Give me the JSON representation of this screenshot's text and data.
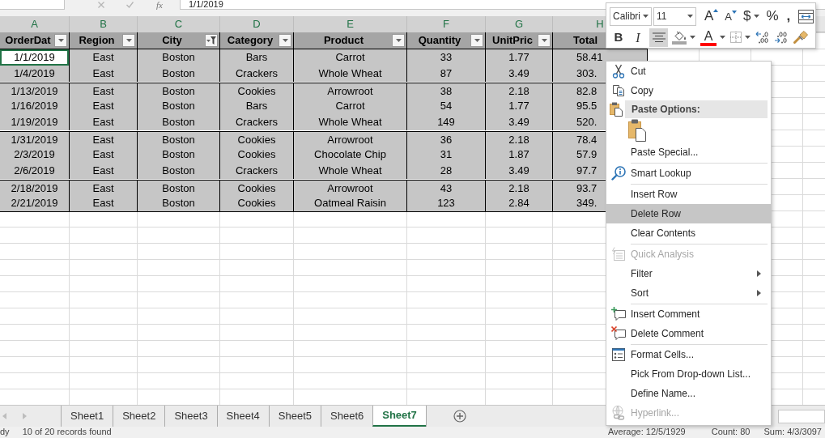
{
  "formula_bar": {
    "function_label": "fx",
    "value": "1/1/2019"
  },
  "columns": [
    {
      "letter": "A",
      "selected": true,
      "active": true,
      "header": "OrderDat",
      "filtered": false
    },
    {
      "letter": "B",
      "selected": true,
      "active": false,
      "header": "Region",
      "filtered": false
    },
    {
      "letter": "C",
      "selected": true,
      "active": false,
      "header": "City",
      "filtered": true
    },
    {
      "letter": "D",
      "selected": true,
      "active": false,
      "header": "Category",
      "filtered": false
    },
    {
      "letter": "E",
      "selected": true,
      "active": false,
      "header": "Product",
      "filtered": false
    },
    {
      "letter": "F",
      "selected": true,
      "active": false,
      "header": "Quantity",
      "filtered": false
    },
    {
      "letter": "G",
      "selected": true,
      "active": false,
      "header": "UnitPric",
      "filtered": false
    },
    {
      "letter": "H",
      "selected": true,
      "active": false,
      "header": "Total"
    }
  ],
  "rows": [
    {
      "cells": [
        "1/1/2019",
        "East",
        "Boston",
        "Bars",
        "Carrot",
        "33",
        "1.77",
        "58.41"
      ],
      "active": true,
      "hidden_rows_above": false
    },
    {
      "cells": [
        "1/4/2019",
        "East",
        "Boston",
        "Crackers",
        "Whole Wheat",
        "87",
        "3.49",
        "303."
      ],
      "active": false,
      "hidden_rows_above": false
    },
    {
      "cells": [
        "1/13/2019",
        "East",
        "Boston",
        "Cookies",
        "Arrowroot",
        "38",
        "2.18",
        "82.8"
      ],
      "active": false,
      "hidden_rows_above": true
    },
    {
      "cells": [
        "1/16/2019",
        "East",
        "Boston",
        "Bars",
        "Carrot",
        "54",
        "1.77",
        "95.5"
      ],
      "active": false,
      "hidden_rows_above": false
    },
    {
      "cells": [
        "1/19/2019",
        "East",
        "Boston",
        "Crackers",
        "Whole Wheat",
        "149",
        "3.49",
        "520."
      ],
      "active": false,
      "hidden_rows_above": false
    },
    {
      "cells": [
        "1/31/2019",
        "East",
        "Boston",
        "Cookies",
        "Arrowroot",
        "36",
        "2.18",
        "78.4"
      ],
      "active": false,
      "hidden_rows_above": true
    },
    {
      "cells": [
        "2/3/2019",
        "East",
        "Boston",
        "Cookies",
        "Chocolate Chip",
        "31",
        "1.87",
        "57.9"
      ],
      "active": false,
      "hidden_rows_above": false
    },
    {
      "cells": [
        "2/6/2019",
        "East",
        "Boston",
        "Crackers",
        "Whole Wheat",
        "28",
        "3.49",
        "97.7"
      ],
      "active": false,
      "hidden_rows_above": false
    },
    {
      "cells": [
        "2/18/2019",
        "East",
        "Boston",
        "Cookies",
        "Arrowroot",
        "43",
        "2.18",
        "93.7"
      ],
      "active": false,
      "hidden_rows_above": true
    },
    {
      "cells": [
        "2/21/2019",
        "East",
        "Boston",
        "Cookies",
        "Oatmeal Raisin",
        "123",
        "2.84",
        "349."
      ],
      "active": false,
      "hidden_rows_above": false
    }
  ],
  "mini_toolbar": {
    "font_name": "Calibri",
    "font_size": "11",
    "upper_buttons": [
      {
        "kind": "grow_font",
        "label": "A"
      },
      {
        "kind": "shrink_font",
        "label": "A"
      },
      {
        "kind": "accounting",
        "label": "$",
        "dropdown": true
      },
      {
        "kind": "percent",
        "label": "%"
      },
      {
        "kind": "comma",
        "label": ","
      },
      {
        "kind": "merge"
      }
    ],
    "lower_buttons": [
      {
        "kind": "bold",
        "label": "B",
        "pressed": false
      },
      {
        "kind": "italic",
        "label": "I",
        "pressed": false
      },
      {
        "kind": "center",
        "pressed": true
      },
      {
        "kind": "fill_color",
        "color": "#a6a6a6",
        "dropdown": true
      },
      {
        "kind": "font_color",
        "label": "A",
        "color": "#ff0000",
        "dropdown": true
      },
      {
        "kind": "borders",
        "dropdown": true
      },
      {
        "kind": "increase_decimal"
      },
      {
        "kind": "decrease_decimal"
      },
      {
        "kind": "format_painter"
      }
    ]
  },
  "context_menu": {
    "items": [
      {
        "kind": "cut",
        "label": "Cut",
        "selected": false,
        "disabled": false,
        "submenu": false
      },
      {
        "kind": "copy",
        "label": "Copy",
        "selected": false,
        "disabled": false,
        "submenu": false
      },
      {
        "kind": "header",
        "label": "Paste Options:"
      },
      {
        "kind": "paste_option"
      },
      {
        "kind": "plain",
        "label": "Paste Special...",
        "selected": false,
        "disabled": false,
        "submenu": false
      },
      {
        "kind": "separator"
      },
      {
        "kind": "lookup",
        "label": "Smart Lookup",
        "selected": false,
        "disabled": false,
        "submenu": false
      },
      {
        "kind": "separator"
      },
      {
        "kind": "plain",
        "label": "Insert Row",
        "selected": false,
        "disabled": false,
        "submenu": false
      },
      {
        "kind": "plain",
        "label": "Delete Row",
        "selected": true,
        "disabled": false,
        "submenu": false
      },
      {
        "kind": "plain",
        "label": "Clear Contents",
        "selected": false,
        "disabled": false,
        "submenu": false
      },
      {
        "kind": "separator"
      },
      {
        "kind": "analysis",
        "label": "Quick Analysis",
        "selected": false,
        "disabled": true,
        "submenu": false
      },
      {
        "kind": "plain",
        "label": "Filter",
        "selected": false,
        "disabled": false,
        "submenu": true
      },
      {
        "kind": "plain",
        "label": "Sort",
        "selected": false,
        "disabled": false,
        "submenu": true
      },
      {
        "kind": "separator"
      },
      {
        "kind": "insert_comment",
        "label": "Insert Comment",
        "selected": false,
        "disabled": false,
        "submenu": false
      },
      {
        "kind": "delete_comment",
        "label": "Delete Comment",
        "selected": false,
        "disabled": false,
        "submenu": false
      },
      {
        "kind": "separator"
      },
      {
        "kind": "format",
        "label": "Format Cells...",
        "selected": false,
        "disabled": false,
        "submenu": false
      },
      {
        "kind": "plain",
        "label": "Pick From Drop-down List...",
        "selected": false,
        "disabled": false,
        "submenu": false
      },
      {
        "kind": "plain",
        "label": "Define Name...",
        "selected": false,
        "disabled": false,
        "submenu": false
      },
      {
        "kind": "hyperlink",
        "label": "Hyperlink...",
        "selected": false,
        "disabled": true,
        "submenu": false
      }
    ]
  },
  "sheet_tabs": [
    {
      "label": "Sheet1",
      "selected": false
    },
    {
      "label": "Sheet2",
      "selected": false
    },
    {
      "label": "Sheet3",
      "selected": false
    },
    {
      "label": "Sheet4",
      "selected": false
    },
    {
      "label": "Sheet5",
      "selected": false
    },
    {
      "label": "Sheet6",
      "selected": false
    },
    {
      "label": "Sheet7",
      "selected": true
    }
  ],
  "status_bar": {
    "mode": "dy",
    "message": "10 of 20 records found",
    "average": "Average: 12/5/1929",
    "count": "Count: 80",
    "sum": "Sum: 4/3/3097"
  }
}
